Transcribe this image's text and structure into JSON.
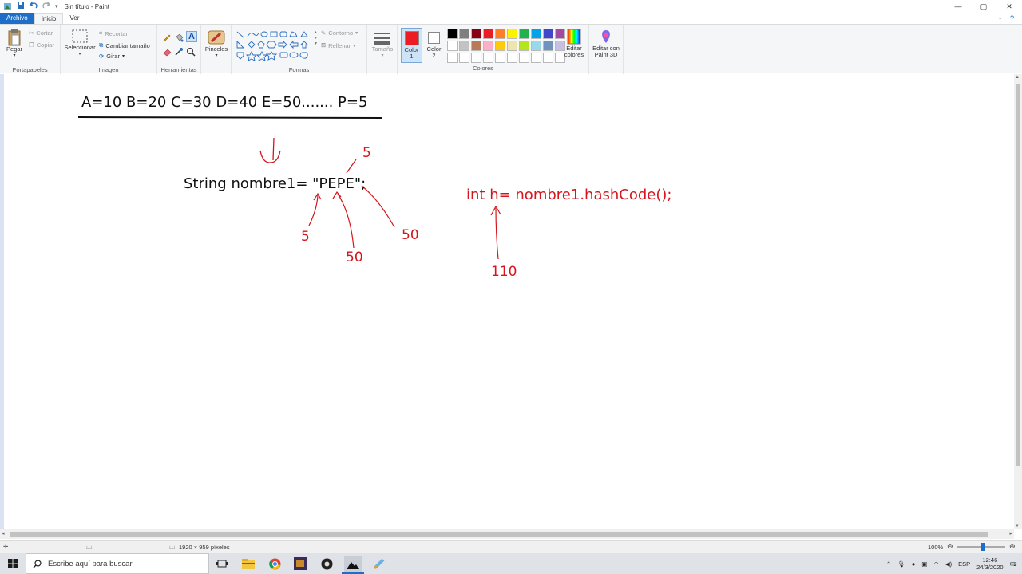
{
  "window": {
    "title": "Sin título - Paint",
    "controls": [
      "—",
      "▢",
      "✕"
    ]
  },
  "tabs": {
    "file": "Archivo",
    "home": "Inicio",
    "view": "Ver"
  },
  "ribbon": {
    "clipboard": {
      "label": "Portapapeles",
      "paste": "Pegar",
      "cut": "Cortar",
      "copy": "Copiar"
    },
    "image": {
      "label": "Imagen",
      "select": "Seleccionar",
      "crop": "Recortar",
      "resize": "Cambiar tamaño",
      "rotate": "Girar"
    },
    "tools": {
      "label": "Herramientas"
    },
    "brushes": {
      "label": "Pinceles"
    },
    "shapes": {
      "label": "Formas",
      "outline": "Contorno",
      "fill": "Rellenar"
    },
    "size": {
      "label": "Tamaño"
    },
    "color1": {
      "label": "Color",
      "num": "1",
      "value": "#ed1c24"
    },
    "color2": {
      "label": "Color",
      "num": "2",
      "value": "#ffffff"
    },
    "colors": {
      "label": "Colores",
      "edit": "Editar",
      "edit2": "colores"
    },
    "paint3d": {
      "label": "Editar con",
      "label2": "Paint 3D"
    },
    "palette": [
      "#000000",
      "#7f7f7f",
      "#880015",
      "#ed1c24",
      "#ff7f27",
      "#fff200",
      "#22b14c",
      "#00a2e8",
      "#3f48cc",
      "#a349a4",
      "#ffffff",
      "#c3c3c3",
      "#b97a57",
      "#ffaec9",
      "#ffc90e",
      "#efe4b0",
      "#b5e61d",
      "#99d9ea",
      "#7092be",
      "#c8bfe7",
      "#ffffff",
      "#ffffff",
      "#ffffff",
      "#ffffff",
      "#ffffff",
      "#ffffff",
      "#ffffff",
      "#ffffff",
      "#ffffff",
      "#ffffff"
    ]
  },
  "canvas": {
    "line1": "A=10 B=20  C=30 D=40  E=50....... P=5",
    "code": "String nombre1= \"PEPE\";",
    "num_5_top": "5",
    "num_5_left": "5",
    "num_50_mid": "50",
    "num_50_right": "50",
    "hash": "int h= nombre1.hashCode();",
    "num_110": "110"
  },
  "status": {
    "dimensions": "1920 × 959 píxeles",
    "zoom": "100%",
    "zoom_level": 1.0
  },
  "taskbar": {
    "search_placeholder": "Escribe aquí para buscar",
    "lang": "ESP",
    "time": "12:46",
    "date": "24/3/2020",
    "notif_count": "2"
  }
}
